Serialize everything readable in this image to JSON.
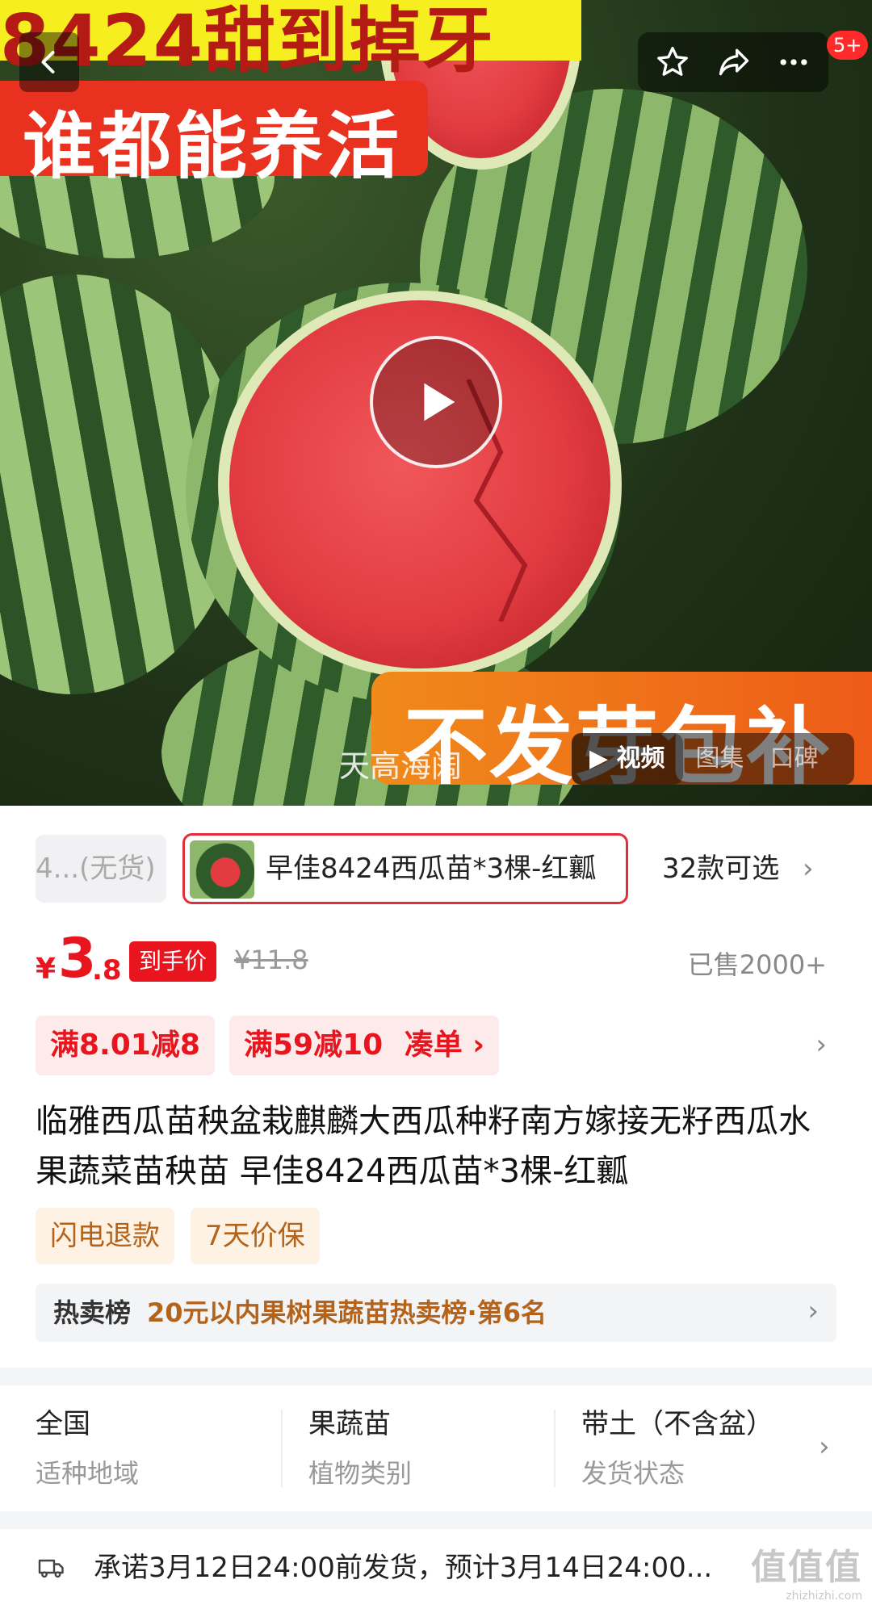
{
  "hero": {
    "banner_top": "8424甜到掉牙",
    "banner_red": "谁都能养活",
    "banner_bottom": "不发芽包补",
    "watermark": "天高海阔",
    "notification_count": "5+",
    "media_tabs": [
      "视频",
      "图集",
      "口碑"
    ]
  },
  "sku": {
    "previous": "4...(无货)",
    "selected": "早佳8424西瓜苗*3棵-红瓤",
    "count": "32款可选"
  },
  "price": {
    "currency": "¥",
    "integer": "3",
    "decimal": ".8",
    "tag": "到手价",
    "original": "¥11.8",
    "sold": "已售2000+"
  },
  "coupons": [
    "满8.01减8",
    "满59减10",
    "凑单 ›"
  ],
  "title": "临雅西瓜苗秧盆栽麒麟大西瓜种籽南方嫁接无籽西瓜水果蔬菜苗秧苗 早佳8424西瓜苗*3棵-红瓤",
  "guarantees": [
    "闪电退款",
    "7天价保"
  ],
  "rank": {
    "prefix": "热卖榜",
    "text": "20元以内果树果蔬苗热卖榜·第6名"
  },
  "attributes": [
    {
      "value": "全国",
      "key": "适种地域"
    },
    {
      "value": "果蔬苗",
      "key": "植物类别"
    },
    {
      "value": "带土（不含盆）",
      "key": "发货状态"
    }
  ],
  "shipping": "承诺3月12日24:00前发货，预计3月14日24:00...",
  "site_watermark": {
    "big": "值值值",
    "small": "zhizhizhi.com"
  },
  "colors": {
    "accent": "#e8141e",
    "gold": "#b5621a"
  }
}
